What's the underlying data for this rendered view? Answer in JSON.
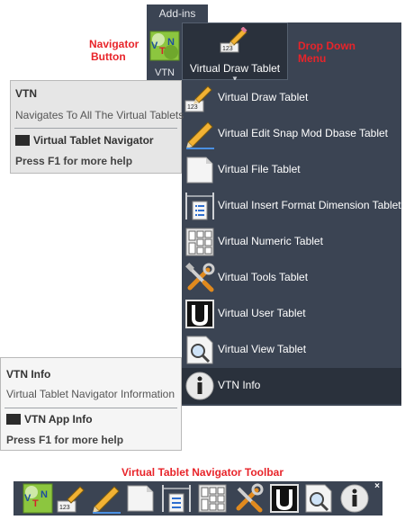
{
  "ribbon": {
    "tab_label": "Add-ins"
  },
  "annotations": {
    "navigator_button": [
      "Navigator",
      "Button"
    ],
    "drop_down_menu": [
      "Drop Down",
      "Menu"
    ],
    "toolbar_title": "Virtual Tablet Navigator Toolbar"
  },
  "navigator_button": {
    "label": "VTN",
    "icon_text": "VTN"
  },
  "dropdown_button": {
    "label": "Virtual Draw Tablet",
    "arrow": "▼"
  },
  "menu": {
    "items": [
      {
        "label": "Virtual Draw Tablet",
        "icon": "pencil-icon"
      },
      {
        "label": "Virtual Edit Snap Mod Dbase Tablet",
        "icon": "big-pencil-icon"
      },
      {
        "label": "Virtual File Tablet",
        "icon": "page-icon"
      },
      {
        "label": "Virtual Insert Format Dimension Tablet",
        "icon": "dimension-icon"
      },
      {
        "label": "Virtual Numeric Tablet",
        "icon": "numeric-grid-icon"
      },
      {
        "label": "Virtual Tools Tablet",
        "icon": "tools-icon"
      },
      {
        "label": "Virtual User Tablet",
        "icon": "user-u-icon"
      },
      {
        "label": "Virtual View Tablet",
        "icon": "magnifier-icon"
      },
      {
        "label": "VTN Info",
        "icon": "info-icon"
      }
    ]
  },
  "tooltip_vtn": {
    "title": "VTN",
    "description": "Navigates To All The Virtual Tablets",
    "command": "Virtual Tablet Navigator",
    "help": "Press F1 for more help"
  },
  "tooltip_info": {
    "title": "VTN Info",
    "description": "Virtual Tablet Navigator Information",
    "command": "VTN App Info",
    "help": "Press F1 for more help"
  },
  "toolbar": {
    "close": "×"
  },
  "colors": {
    "panel": "#3b4453",
    "dark_panel": "#2a313c",
    "annotation_red": "#e8242a"
  }
}
